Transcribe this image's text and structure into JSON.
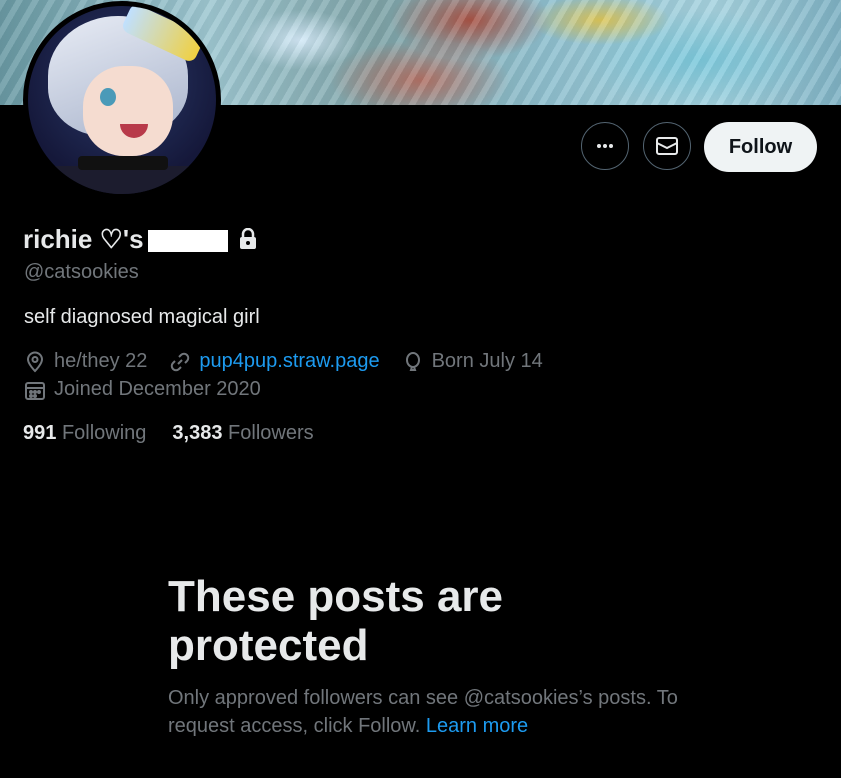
{
  "profile": {
    "display_name": "richie ♡'s",
    "handle": "@catsookies",
    "bio": "self diagnosed magical girl",
    "pronouns": "he/they 22",
    "website": "pup4pup.straw.page",
    "birthday": "Born July 14",
    "joined": "Joined December 2020",
    "following_count": "991",
    "following_label": "Following",
    "followers_count": "3,383",
    "followers_label": "Followers"
  },
  "actions": {
    "follow_label": "Follow"
  },
  "protected": {
    "title": "These posts are protected",
    "description": "Only approved followers can see @catsookies’s posts. To request access, click Follow.",
    "learn_more": "Learn more"
  },
  "icons": {
    "more": "more-dots-icon",
    "message": "envelope-icon",
    "lock": "lock-icon",
    "location": "location-pin-icon",
    "link": "link-icon",
    "birthday": "balloon-icon",
    "calendar": "calendar-icon"
  },
  "colors": {
    "background": "#000000",
    "text": "#e7e9ea",
    "secondary": "#71767b",
    "link": "#1d9bf0",
    "follow_bg": "#eff3f4"
  }
}
